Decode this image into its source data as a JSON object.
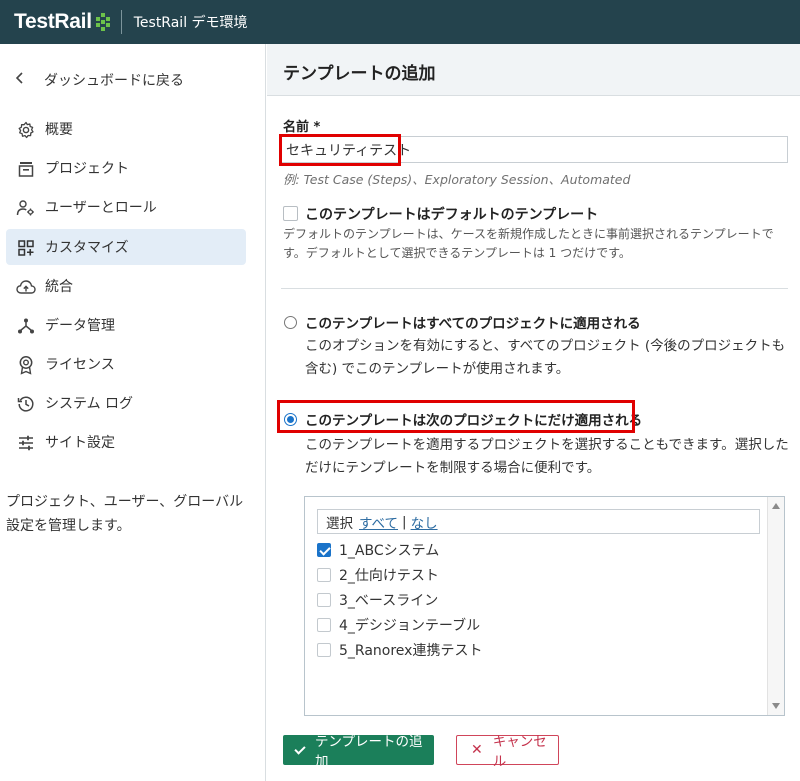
{
  "topbar": {
    "logo": "TestRail",
    "environment": "TestRail デモ環境",
    "colors": {
      "background": "#24434d",
      "logo_mark": "#6cc24a"
    }
  },
  "sidebar": {
    "back": "ダッシュボードに戻る",
    "items": [
      {
        "label": "概要",
        "icon": "gear-icon"
      },
      {
        "label": "プロジェクト",
        "icon": "project-icon"
      },
      {
        "label": "ユーザーとロール",
        "icon": "users-roles-icon"
      },
      {
        "label": "カスタマイズ",
        "icon": "customize-icon",
        "active": true
      },
      {
        "label": "統合",
        "icon": "cloud-upload-icon"
      },
      {
        "label": "データ管理",
        "icon": "data-management-icon"
      },
      {
        "label": "ライセンス",
        "icon": "license-icon"
      },
      {
        "label": "システム ログ",
        "icon": "history-icon"
      },
      {
        "label": "サイト設定",
        "icon": "sliders-icon"
      }
    ],
    "description": "プロジェクト、ユーザー、グローバル設定を管理します。"
  },
  "main": {
    "title": "テンプレートの追加",
    "name_label": "名前 *",
    "name_value": "セキュリティテスト",
    "name_hint": "例: Test Case (Steps)、Exploratory Session、Automated",
    "default_checkbox": {
      "label": "このテンプレートはデフォルトのテンプレート",
      "checked": false,
      "description": "デフォルトのテンプレートは、ケースを新規作成したときに事前選択されるテンプレートです。デフォルトとして選択できるテンプレートは 1 つだけです。"
    },
    "radio_all": {
      "label": "このテンプレートはすべてのプロジェクトに適用される",
      "checked": false,
      "description": "このオプションを有効にすると、すべてのプロジェクト (今後のプロジェクトも含む) でこのテンプレートが使用されます。"
    },
    "radio_selected": {
      "label": "このテンプレートは次のプロジェクトにだけ適用される",
      "checked": true,
      "description": "このテンプレートを適用するプロジェクトを選択することもできます。選択しただけにテンプレートを制限する場合に便利です。"
    },
    "project_select": {
      "select_label": "選択",
      "all_link": "すべて",
      "separator": "|",
      "none_link": "なし",
      "projects": [
        {
          "name": "1_ABCシステム",
          "checked": true
        },
        {
          "name": "2_仕向けテスト",
          "checked": false
        },
        {
          "name": "3_ベースライン",
          "checked": false
        },
        {
          "name": "4_デシジョンテーブル",
          "checked": false
        },
        {
          "name": "5_Ranorex連携テスト",
          "checked": false
        }
      ]
    },
    "buttons": {
      "add": "テンプレートの追加",
      "cancel": "キャンセル"
    },
    "colors": {
      "primary": "#1b7f5a",
      "danger": "#c4314b",
      "accent": "#1a73c9",
      "highlight": "#e00000"
    }
  }
}
